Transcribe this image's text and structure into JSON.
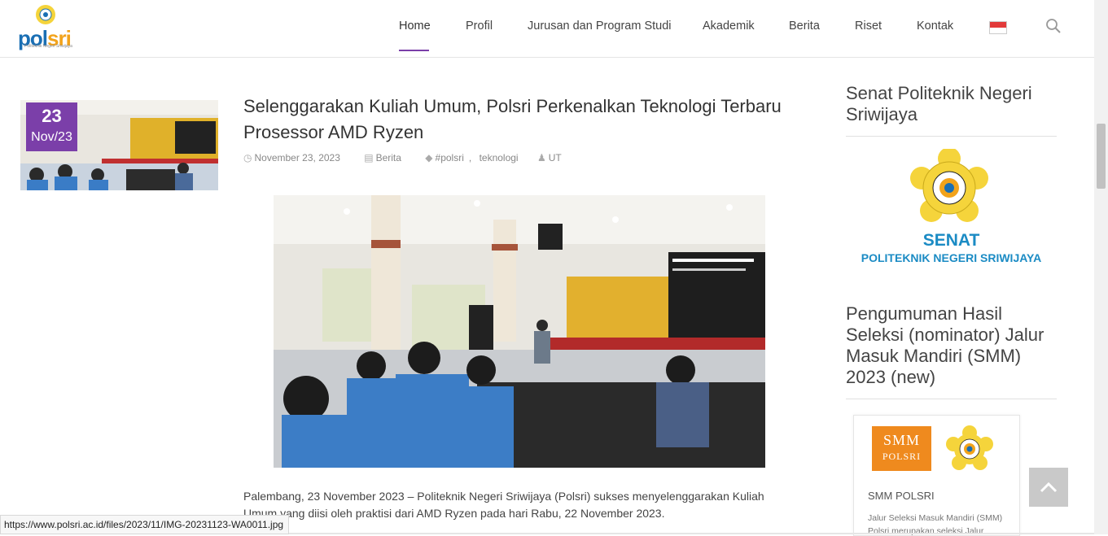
{
  "header": {
    "logo_text_a": "pol",
    "logo_text_b": "sri",
    "logo_sub": "Politeknik Negeri Sriwijaya",
    "nav": [
      {
        "label": "Home"
      },
      {
        "label": "Profil"
      },
      {
        "label": "Jurusan dan Program Studi"
      },
      {
        "label": "Akademik"
      },
      {
        "label": "Berita"
      },
      {
        "label": "Riset"
      },
      {
        "label": "Kontak"
      }
    ],
    "active_color": "#7b3fa9"
  },
  "post": {
    "date_day": "23",
    "date_month": "Nov/23",
    "title": "Selenggarakan Kuliah Umum, Polsri Perkenalkan Teknologi Terbaru Prosessor AMD Ryzen",
    "meta": {
      "date": "November 23, 2023",
      "category": "Berita",
      "tag1": "#polsri",
      "tag2": "teknologi",
      "author": "UT"
    },
    "body": "Palembang, 23 November 2023 – Politeknik Negeri Sriwijaya (Polsri) sukses menyelenggarakan Kuliah Umum yang diisi oleh praktisi dari AMD Ryzen pada hari Rabu, 22 November 2023."
  },
  "sidebar": {
    "widget1_title": "Senat Politeknik Negeri Sriwijaya",
    "senat_big": "SENAT",
    "senat_small": "POLITEKNIK NEGERI SRIWIJAYA",
    "widget2_title": "Pengumuman Hasil Seleksi (nominator) Jalur Masuk Mandiri (SMM) 2023 (new)",
    "smm_badge_a": "SMM",
    "smm_badge_b": "POLSRI",
    "smm_name": "SMM POLSRI",
    "smm_desc": "Jalur Seleksi Masuk Mandiri (SMM) Polsri merupakan seleksi Jalur"
  },
  "status_url": "https://www.polsri.ac.id/files/2023/11/IMG-20231123-WA0011.jpg"
}
